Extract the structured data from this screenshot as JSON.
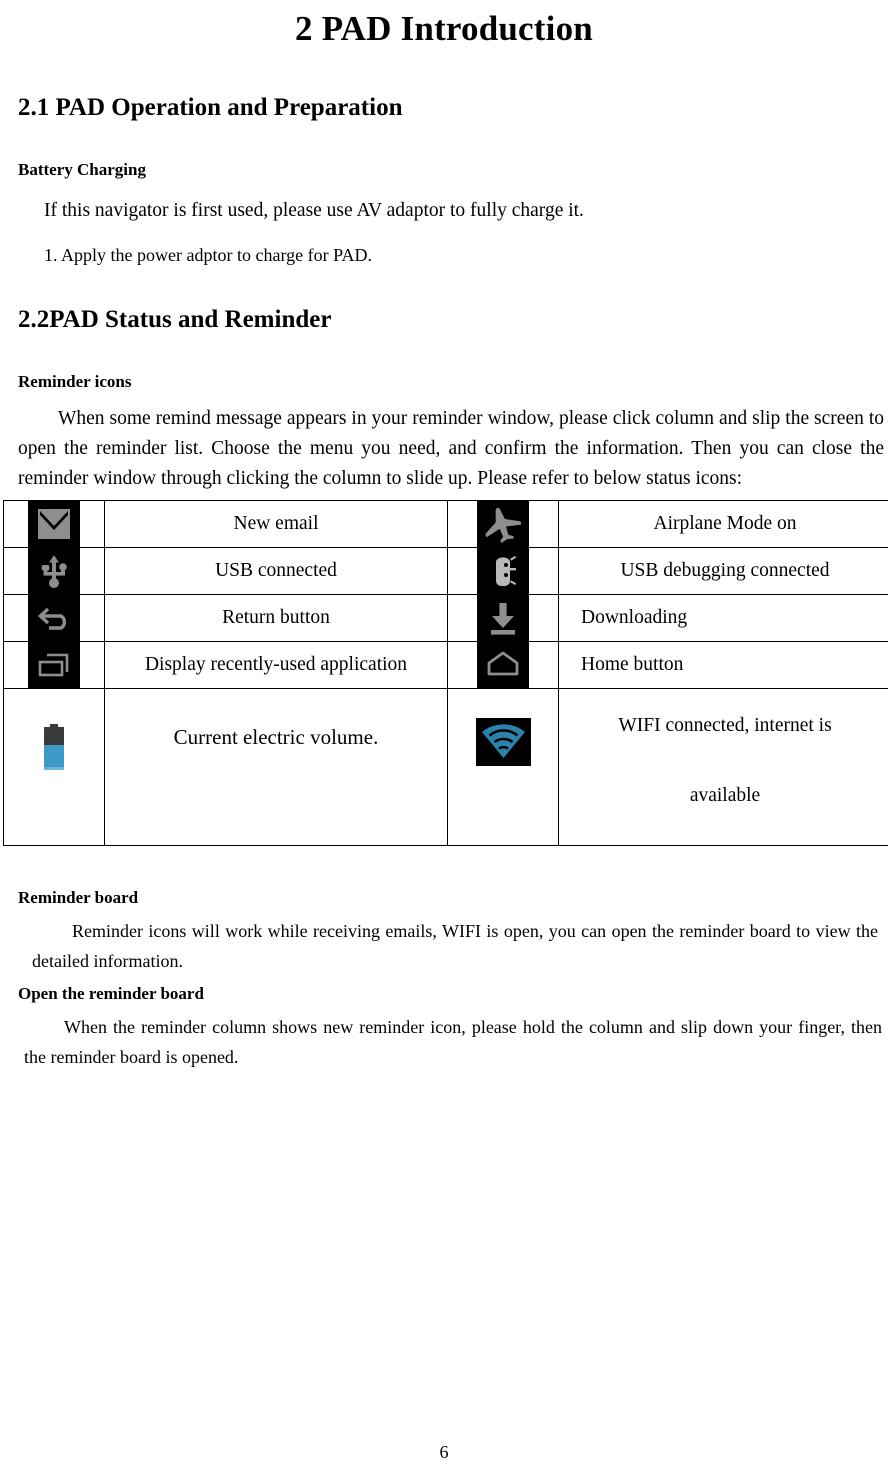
{
  "document": {
    "title": "2 PAD Introduction",
    "page_number": "6"
  },
  "sections": {
    "s21": {
      "heading": "2.1 PAD Operation and Preparation",
      "subheading": "Battery Charging",
      "line1": "If this navigator is first used, please use AV adaptor to fully charge it.",
      "line2": "1. Apply the power adptor to charge for PAD."
    },
    "s22": {
      "heading": "2.2PAD Status and Reminder",
      "subheading": "Reminder icons",
      "paragraph": "When some remind message appears in your reminder window, please click column and slip the screen to open the reminder list. Choose the menu you need, and confirm the information. Then you can close the reminder window through clicking the column to slide up. Please refer to below status icons:"
    },
    "reminder_board": {
      "heading": "Reminder board",
      "paragraph": "Reminder icons will work while receiving emails, WIFI is open, you can open the reminder board to view the detailed information."
    },
    "open_reminder_board": {
      "heading": "Open the reminder board",
      "paragraph": "When the reminder column shows new reminder icon, please hold the column and slip down your finger, then the reminder board is opened."
    }
  },
  "status_table": {
    "rows": [
      {
        "left": {
          "icon": "new-email-icon",
          "label": "New email"
        },
        "right": {
          "icon": "airplane-mode-icon",
          "label": "Airplane Mode on"
        }
      },
      {
        "left": {
          "icon": "usb-connected-icon",
          "label": "USB connected"
        },
        "right": {
          "icon": "usb-debugging-icon",
          "label": "USB debugging connected"
        }
      },
      {
        "left": {
          "icon": "return-button-icon",
          "label": "Return button"
        },
        "right": {
          "icon": "downloading-icon",
          "label": "Downloading"
        }
      },
      {
        "left": {
          "icon": "recent-apps-icon",
          "label": "Display recently-used application"
        },
        "right": {
          "icon": "home-button-icon",
          "label": "Home button"
        }
      },
      {
        "left": {
          "icon": "battery-icon",
          "label": "Current electric volume."
        },
        "right": {
          "icon": "wifi-connected-icon",
          "label_line1": "WIFI connected, internet is",
          "label_line2": "available"
        }
      }
    ]
  },
  "colors": {
    "icon_tile_background": "#000000",
    "icon_glyph_gray": "#8e8e8e",
    "battery_blue": "#3d9ac7",
    "battery_dark": "#3a3a3a",
    "wifi_blue": "#2b83ab",
    "table_border": "#000000",
    "text": "#000000"
  }
}
